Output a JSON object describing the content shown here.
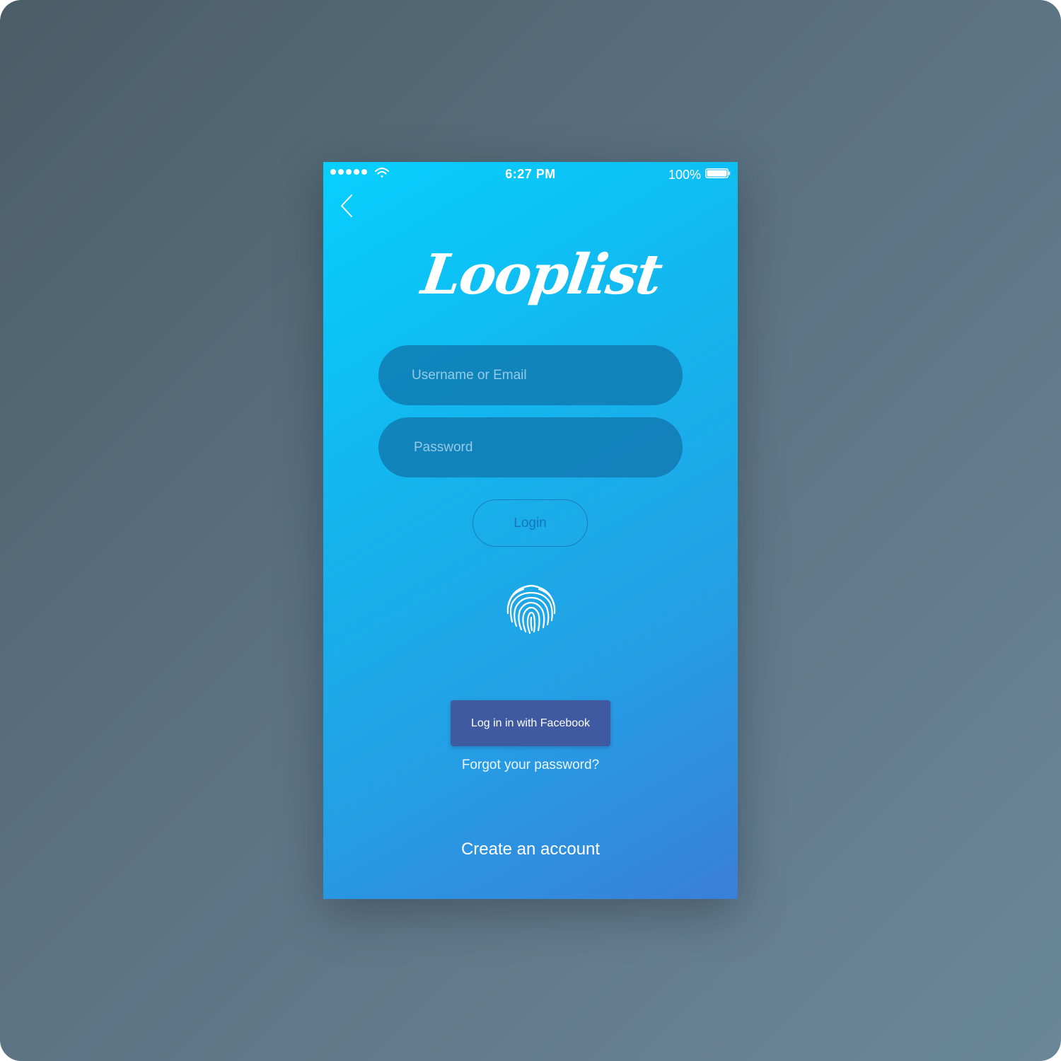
{
  "status_bar": {
    "time": "6:27 PM",
    "battery_percent": "100%",
    "signal_icon": "signal-dots-icon",
    "wifi_icon": "wifi-icon",
    "battery_icon": "battery-icon"
  },
  "navigation": {
    "back_icon": "chevron-left-icon"
  },
  "logo": {
    "text": "Looplist"
  },
  "form": {
    "username_placeholder": "Username or Email",
    "password_placeholder": "Password",
    "login_label": "Login",
    "fingerprint_icon": "fingerprint-icon"
  },
  "social": {
    "facebook_label": "Log in in with Facebook"
  },
  "links": {
    "forgot_password": "Forgot your password?",
    "create_account": "Create an account"
  },
  "colors": {
    "background_gradient_start": "#06d0ff",
    "background_gradient_end": "#3a7fd8",
    "field_background": "#1070a8",
    "facebook_blue": "#3f5aa0",
    "page_backdrop": "#5b7282"
  }
}
